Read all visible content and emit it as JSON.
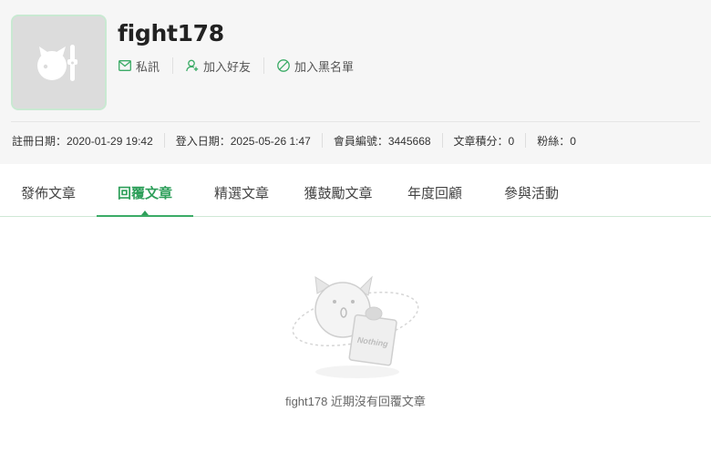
{
  "profile": {
    "username": "fight178",
    "avatar_icon": "bomb-cat-avatar-icon",
    "actions": [
      {
        "label": "私訊",
        "icon": "mail-icon"
      },
      {
        "label": "加入好友",
        "icon": "add-friend-icon"
      },
      {
        "label": "加入黑名單",
        "icon": "block-icon"
      }
    ],
    "stats": {
      "register": "註冊日期：2020-01-29 19:42",
      "login": "登入日期：2025-05-26 1:47",
      "member_no": "會員編號：3445668",
      "points": "文章積分：0",
      "fans": "粉絲：0"
    }
  },
  "tabs": [
    {
      "label": "發佈文章",
      "active": false
    },
    {
      "label": "回覆文章",
      "active": true
    },
    {
      "label": "精選文章",
      "active": false
    },
    {
      "label": "獲鼓勵文章",
      "active": false
    },
    {
      "label": "年度回顧",
      "active": false
    },
    {
      "label": "參與活動",
      "active": false
    }
  ],
  "empty_state": {
    "illustration_text": "Nothing",
    "message": "fight178 近期沒有回覆文章"
  },
  "colors": {
    "accent": "#2e9f5a",
    "card_bg": "#f6f6f6",
    "avatar_border": "#c9e9d2"
  }
}
